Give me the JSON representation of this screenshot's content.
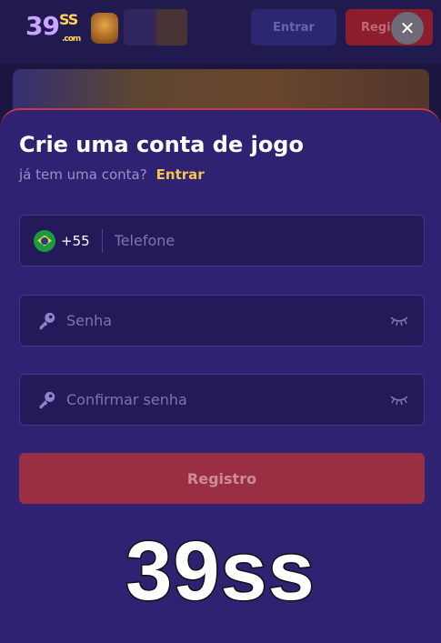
{
  "background": {
    "logo_main": "39",
    "logo_ss": "SS",
    "logo_com": ".com",
    "login_label": "Entrar",
    "register_label": "Registro"
  },
  "modal": {
    "close_symbol": "✕",
    "title": "Crie uma conta de jogo",
    "subtitle": "já tem uma conta?",
    "login_link": "Entrar",
    "phone": {
      "country_flag": "brazil-flag-icon",
      "dial_code": "+55",
      "placeholder": "Telefone",
      "value": ""
    },
    "password": {
      "placeholder": "Senha",
      "value": ""
    },
    "confirm_password": {
      "placeholder": "Confirmar senha",
      "value": ""
    },
    "submit_label": "Registro"
  },
  "brand_text": "39ss",
  "colors": {
    "accent_yellow": "#f4c54a",
    "modal_bg": "#2f2272",
    "submit_bg": "#9a2e42"
  }
}
